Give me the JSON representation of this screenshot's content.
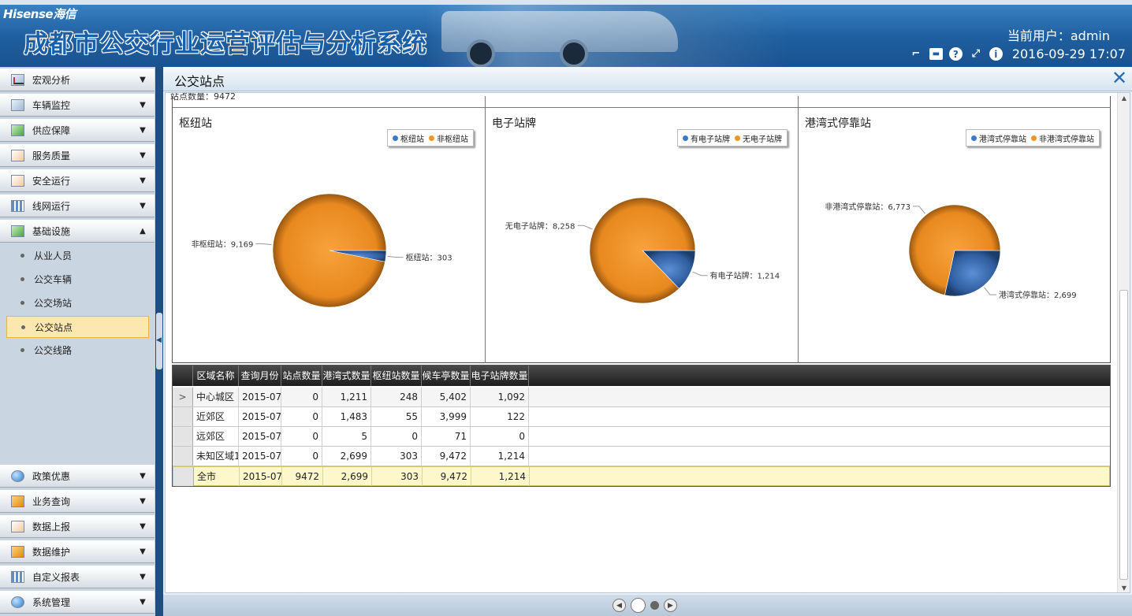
{
  "header": {
    "logo": "Hisense海信",
    "system_title": "成都市公交行业运营评估与分析系统",
    "current_user": "当前用户：admin",
    "datetime": "2016-09-29 17:07"
  },
  "sidebar": {
    "items": [
      {
        "label": "宏观分析",
        "icon": "line-chart-icon",
        "expanded": false
      },
      {
        "label": "车辆监控",
        "icon": "camera-icon",
        "expanded": false
      },
      {
        "label": "供应保障",
        "icon": "supply-icon",
        "expanded": false
      },
      {
        "label": "服务质量",
        "icon": "pencil-icon",
        "expanded": false
      },
      {
        "label": "安全运行",
        "icon": "pencil-icon",
        "expanded": false
      },
      {
        "label": "线网运行",
        "icon": "grid-icon",
        "expanded": false
      },
      {
        "label": "基础设施",
        "icon": "money-icon",
        "expanded": true
      }
    ],
    "sub_items": [
      {
        "label": "从业人员",
        "active": false
      },
      {
        "label": "公交车辆",
        "active": false
      },
      {
        "label": "公交场站",
        "active": false
      },
      {
        "label": "公交站点",
        "active": true
      },
      {
        "label": "公交线路",
        "active": false
      }
    ],
    "bottom_items": [
      {
        "label": "政策优惠",
        "icon": "globe-icon"
      },
      {
        "label": "业务查询",
        "icon": "trend-icon"
      },
      {
        "label": "数据上报",
        "icon": "pencil-icon"
      },
      {
        "label": "数据维护",
        "icon": "trend-icon"
      },
      {
        "label": "自定义报表",
        "icon": "grid-icon"
      },
      {
        "label": "系统管理",
        "icon": "globe-icon"
      }
    ]
  },
  "main": {
    "title": "公交站点",
    "station_count": "站点数量：9472"
  },
  "chart_data": [
    {
      "type": "pie",
      "title": "枢纽站",
      "legend": [
        "枢纽站",
        "非枢纽站"
      ],
      "slices": [
        {
          "name": "枢纽站",
          "value": 303,
          "label": "枢纽站：303",
          "color": "#2f5d9e"
        },
        {
          "name": "非枢纽站",
          "value": 9169,
          "label": "非枢纽站：9,169",
          "color": "#e8891e"
        }
      ]
    },
    {
      "type": "pie",
      "title": "电子站牌",
      "legend": [
        "有电子站牌",
        "无电子站牌"
      ],
      "slices": [
        {
          "name": "有电子站牌",
          "value": 1214,
          "label": "有电子站牌：1,214",
          "color": "#2f5d9e"
        },
        {
          "name": "无电子站牌",
          "value": 8258,
          "label": "无电子站牌：8,258",
          "color": "#e8891e"
        }
      ]
    },
    {
      "type": "pie",
      "title": "港湾式停靠站",
      "legend": [
        "港湾式停靠站",
        "非港湾式停靠站"
      ],
      "slices": [
        {
          "name": "港湾式停靠站",
          "value": 2699,
          "label": "港湾式停靠站：2,699",
          "color": "#2f5d9e"
        },
        {
          "name": "非港湾式停靠站",
          "value": 6773,
          "label": "非港湾式停靠站：6,773",
          "color": "#e8891e"
        }
      ]
    }
  ],
  "table": {
    "columns": [
      "区域名称",
      "查询月份",
      "站点数量",
      "港湾式数量",
      "枢纽站数量",
      "候车亭数量",
      "电子站牌数量"
    ],
    "rows": [
      [
        "中心城区",
        "2015-07",
        "0",
        "1,211",
        "248",
        "5,402",
        "1,092"
      ],
      [
        "近郊区",
        "2015-07",
        "0",
        "1,483",
        "55",
        "3,999",
        "122"
      ],
      [
        "远郊区",
        "2015-07",
        "0",
        "5",
        "0",
        "71",
        "0"
      ],
      [
        "未知区域1",
        "2015-07",
        "0",
        "2,699",
        "303",
        "9,472",
        "1,214"
      ],
      [
        "全市",
        "2015-07",
        "9472",
        "2,699",
        "303",
        "9,472",
        "1,214"
      ]
    ],
    "row_indicator": ">"
  },
  "colors": {
    "accent": "#1f5fa0",
    "pie_blue": "#2f5d9e",
    "pie_orange": "#e8891e",
    "active_menu": "#fde7b0",
    "total_row": "#fdf7c9"
  }
}
